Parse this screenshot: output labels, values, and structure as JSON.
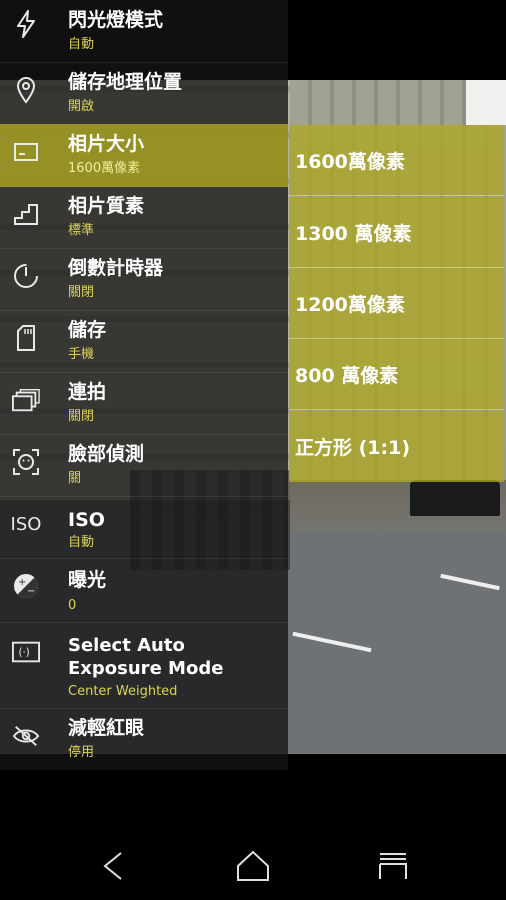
{
  "settings": [
    {
      "title": "閃光燈模式",
      "value": "自動",
      "icon": "flash-icon"
    },
    {
      "title": "儲存地理位置",
      "value": "開啟",
      "icon": "location-pin-icon"
    },
    {
      "title": "相片大小",
      "value": "1600萬像素",
      "icon": "photo-size-icon",
      "selected": true
    },
    {
      "title": "相片質素",
      "value": "標準",
      "icon": "quality-stairs-icon"
    },
    {
      "title": "倒數計時器",
      "value": "關閉",
      "icon": "timer-icon"
    },
    {
      "title": "儲存",
      "value": "手機",
      "icon": "storage-card-icon"
    },
    {
      "title": "連拍",
      "value": "關閉",
      "icon": "burst-icon"
    },
    {
      "title": "臉部偵測",
      "value": "關",
      "icon": "face-detect-icon"
    },
    {
      "title": "ISO",
      "value": "自動",
      "icon": "iso-icon",
      "icon_text": "ISO"
    },
    {
      "title": "曝光",
      "value": "0",
      "icon": "exposure-icon"
    },
    {
      "title": "Select Auto Exposure Mode",
      "value": "Center Weighted",
      "icon": "metering-icon"
    },
    {
      "title": "減輕紅眼",
      "value": "停用",
      "icon": "red-eye-icon"
    }
  ],
  "photo_size_options": [
    "1600萬像素",
    "1300 萬像素",
    "1200萬像素",
    "800 萬像素",
    "正方形 (1:1)"
  ],
  "navigation": {
    "back": "back-icon",
    "home": "home-icon",
    "recents": "recents-icon"
  },
  "colors": {
    "accent": "#ddd455",
    "selected_bg": "#b0ab24",
    "panel_bg": "#141414"
  }
}
